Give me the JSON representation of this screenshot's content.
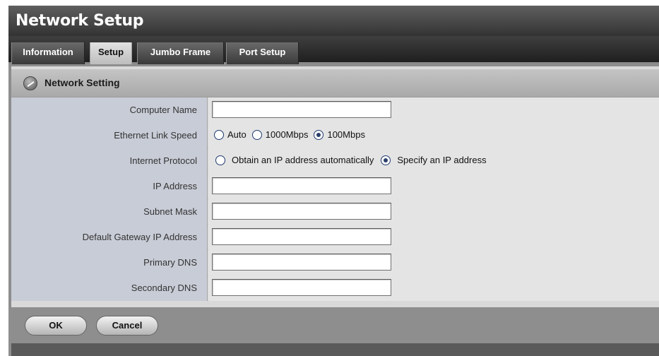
{
  "window": {
    "title": "Network Setup"
  },
  "tabs": [
    {
      "label": "Information",
      "active": false
    },
    {
      "label": "Setup",
      "active": true
    },
    {
      "label": "Jumbo Frame",
      "active": false
    },
    {
      "label": "Port Setup",
      "active": false
    }
  ],
  "section": {
    "title": "Network Setting",
    "icon": "network-globe-icon"
  },
  "form": {
    "computer_name": {
      "label": "Computer Name",
      "value": ""
    },
    "link_speed": {
      "label": "Ethernet Link Speed",
      "options": [
        {
          "label": "Auto",
          "checked": false
        },
        {
          "label": "1000Mbps",
          "checked": false
        },
        {
          "label": "100Mbps",
          "checked": true
        }
      ]
    },
    "internet_protocol": {
      "label": "Internet Protocol",
      "options": [
        {
          "label": "Obtain an IP address automatically",
          "checked": false
        },
        {
          "label": "Specify an IP address",
          "checked": true
        }
      ]
    },
    "ip_address": {
      "label": "IP Address",
      "value": ""
    },
    "subnet_mask": {
      "label": "Subnet Mask",
      "value": ""
    },
    "gateway": {
      "label": "Default Gateway IP Address",
      "value": ""
    },
    "primary_dns": {
      "label": "Primary DNS",
      "value": ""
    },
    "secondary_dns": {
      "label": "Secondary DNS",
      "value": ""
    }
  },
  "buttons": {
    "ok": "OK",
    "cancel": "Cancel"
  }
}
